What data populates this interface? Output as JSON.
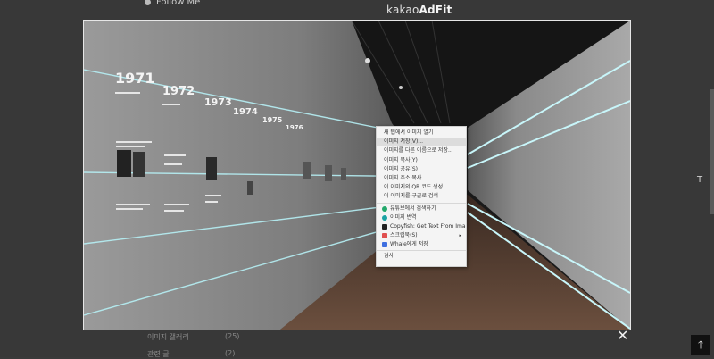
{
  "background_page": {
    "follow_label": "Follow Me",
    "ad_brand_prefix": "kakao",
    "ad_brand_suffix": "AdFit",
    "row1_label": "이미지 갤러리",
    "row1_value": "(25)",
    "row2_label": "관련 글",
    "row2_value": "(2)"
  },
  "lightbox": {
    "year_labels": [
      "1971",
      "1972",
      "1973",
      "1974",
      "1975",
      "1976"
    ],
    "close_icon": "close-x-icon",
    "context_menu": {
      "items": [
        {
          "label": "새 탭에서 이미지 열기",
          "highlight": false
        },
        {
          "label": "이미지 저장(V)...",
          "highlight": true
        },
        {
          "label": "이미지를 다른 이름으로 저장...",
          "highlight": false
        },
        {
          "label": "이미지 복사(Y)",
          "highlight": false
        },
        {
          "label": "이미지 공유(S)",
          "highlight": false
        },
        {
          "label": "이미지 주소 복사",
          "highlight": false
        },
        {
          "label": "이 이미지의 QR 코드 생성",
          "highlight": false
        },
        {
          "label": "이 이미지를 구글로 검색",
          "highlight": false
        }
      ],
      "extensions": [
        {
          "label": "유튜브에서 검색하기",
          "icon": "green-circle-icon",
          "color": "#22a86b",
          "shape": "dot"
        },
        {
          "label": "이미지 번역",
          "icon": "teal-circle-icon",
          "color": "#1aa3a3",
          "shape": "dot"
        },
        {
          "label": "Copyfish: Get Text From Image",
          "icon": "fish-icon",
          "color": "#222222",
          "shape": "sq"
        },
        {
          "label": "스크랩북(S)",
          "icon": "red-square-icon",
          "color": "#e05050",
          "shape": "sq",
          "submenu": true
        },
        {
          "label": "Whale에게 저장",
          "icon": "blue-square-icon",
          "color": "#3f6fe0",
          "shape": "sq"
        }
      ],
      "inspect_label": "검사"
    }
  },
  "scroll_top_icon": "arrow-up-icon",
  "colors": {
    "overlay": "#000000",
    "highlight": "#dcdcdc",
    "accent_line": "#9ee6ee"
  }
}
